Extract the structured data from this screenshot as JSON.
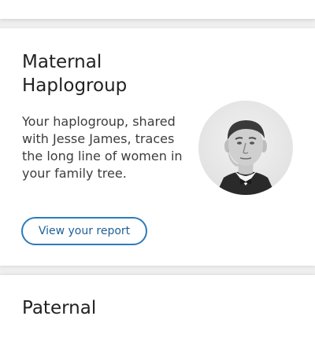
{
  "maternal_card": {
    "title_line1": "Maternal",
    "title_line2": "Haplogroup",
    "desc_line1": "Your haplogroup, shared",
    "desc_line2": "with Jesse James, traces",
    "desc_line3": "the long line of women in",
    "desc_line4": "your family tree.",
    "portrait": "portrait-of-jesse-james",
    "button_label": "View your report",
    "button_color": "#2b7bbd"
  },
  "paternal_card": {
    "title": "Paternal"
  }
}
